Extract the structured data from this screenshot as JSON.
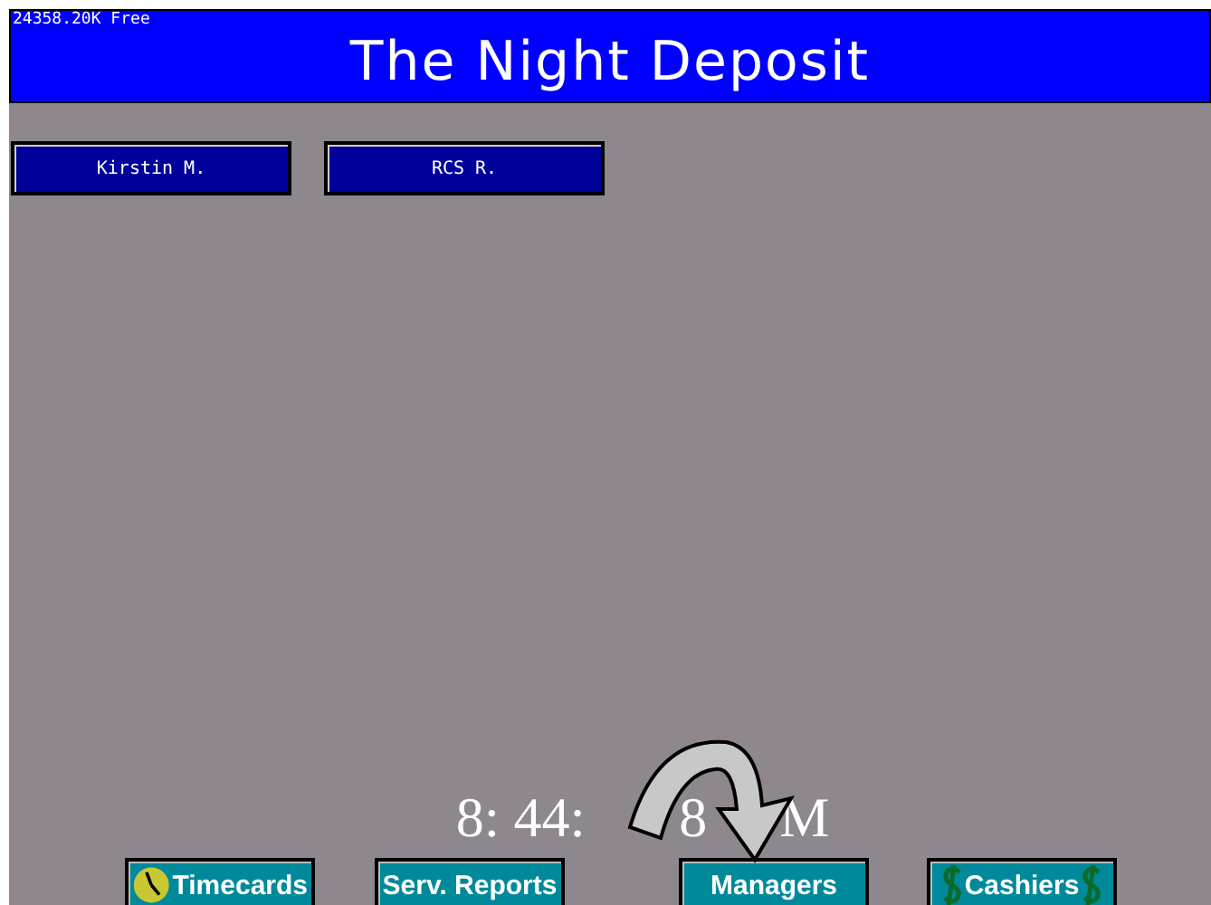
{
  "memory_status": "24358.20K Free",
  "title": "The Night Deposit",
  "employees": [
    {
      "label": "Kirstin M."
    },
    {
      "label": "RCS R."
    }
  ],
  "clock_parts": [
    "8: 44: ",
    "8",
    "M"
  ],
  "buttons": [
    {
      "label": "Timecards",
      "kind": "clock"
    },
    {
      "label": "Serv. Reports",
      "kind": "plain"
    },
    {
      "label": "Managers",
      "kind": "plain"
    },
    {
      "label": "Cashiers",
      "kind": "dollar"
    }
  ]
}
